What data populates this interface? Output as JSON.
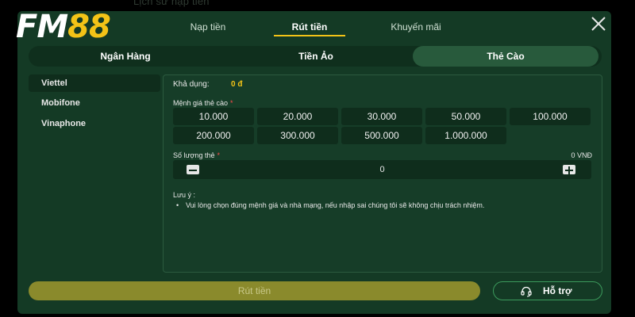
{
  "background": {
    "title": "Lịch sử nạp tiền"
  },
  "logo": {
    "text_white": "FM",
    "text_yellow": "88"
  },
  "colors": {
    "accent": "#f3c317",
    "panel": "#143a25",
    "button": "#8a8a2c"
  },
  "top_tabs": [
    {
      "label": "Nạp tiền",
      "active": false
    },
    {
      "label": "Rút tiền",
      "active": true
    },
    {
      "label": "Khuyến mãi",
      "active": false
    }
  ],
  "segments": [
    {
      "label": "Ngân Hàng",
      "active": false
    },
    {
      "label": "Tiền Ảo",
      "active": false
    },
    {
      "label": "Thẻ Cào",
      "active": true
    }
  ],
  "carriers": [
    {
      "label": "Viettel",
      "active": true
    },
    {
      "label": "Mobifone",
      "active": false
    },
    {
      "label": "Vinaphone",
      "active": false
    }
  ],
  "balance": {
    "label": "Khả dụng:",
    "value": "0 đ"
  },
  "denomination": {
    "label": "Mệnh giá thẻ cào",
    "required_mark": "*",
    "options": [
      "10.000",
      "20.000",
      "30.000",
      "50.000",
      "100.000",
      "200.000",
      "300.000",
      "500.000",
      "1.000.000"
    ]
  },
  "quantity": {
    "label": "Số lượng thẻ",
    "required_mark": "*",
    "value": "0",
    "total": "0 VNĐ"
  },
  "note": {
    "title": "Lưu ý :",
    "bullet": "•",
    "text": "Vui lòng chọn đúng mệnh giá và nhà mạng, nếu nhập sai chúng tôi sẽ không chịu trách nhiệm."
  },
  "actions": {
    "withdraw_label": "Rút tiền",
    "support_label": "Hỗ trợ"
  },
  "icons": {
    "close": "close-icon",
    "minus": "minus-icon",
    "plus": "plus-icon",
    "support": "headset-icon"
  }
}
